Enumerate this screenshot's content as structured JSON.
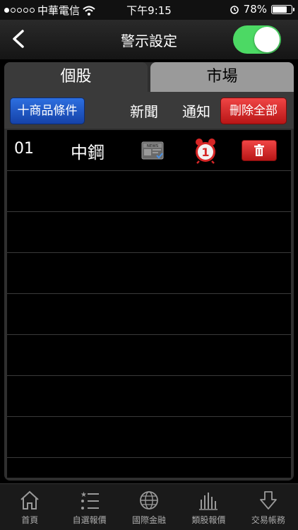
{
  "status_bar": {
    "carrier": "中華電信",
    "time": "下午9:15",
    "battery": "78%",
    "battery_level": 0.78
  },
  "nav": {
    "title": "警示設定",
    "toggle_on": true
  },
  "tabs": [
    {
      "label": "個股",
      "active": true
    },
    {
      "label": "市場",
      "active": false
    }
  ],
  "toolbar": {
    "add_label": "十商品條件",
    "news_label": "新聞",
    "notify_label": "通知",
    "delete_all_label": "刪除全部"
  },
  "rows": [
    {
      "code": "01",
      "name": "中鋼",
      "notify_count": "1"
    }
  ],
  "tabbar": [
    {
      "label": "首頁",
      "icon": "home-icon"
    },
    {
      "label": "自選報價",
      "icon": "list-icon"
    },
    {
      "label": "國際金融",
      "icon": "globe-icon"
    },
    {
      "label": "類股報價",
      "icon": "bars-icon"
    },
    {
      "label": "交易帳務",
      "icon": "down-arrow-icon"
    }
  ],
  "colors": {
    "toggle": "#4cd964",
    "add_button": "#1e5bd0",
    "delete": "#d62626"
  }
}
